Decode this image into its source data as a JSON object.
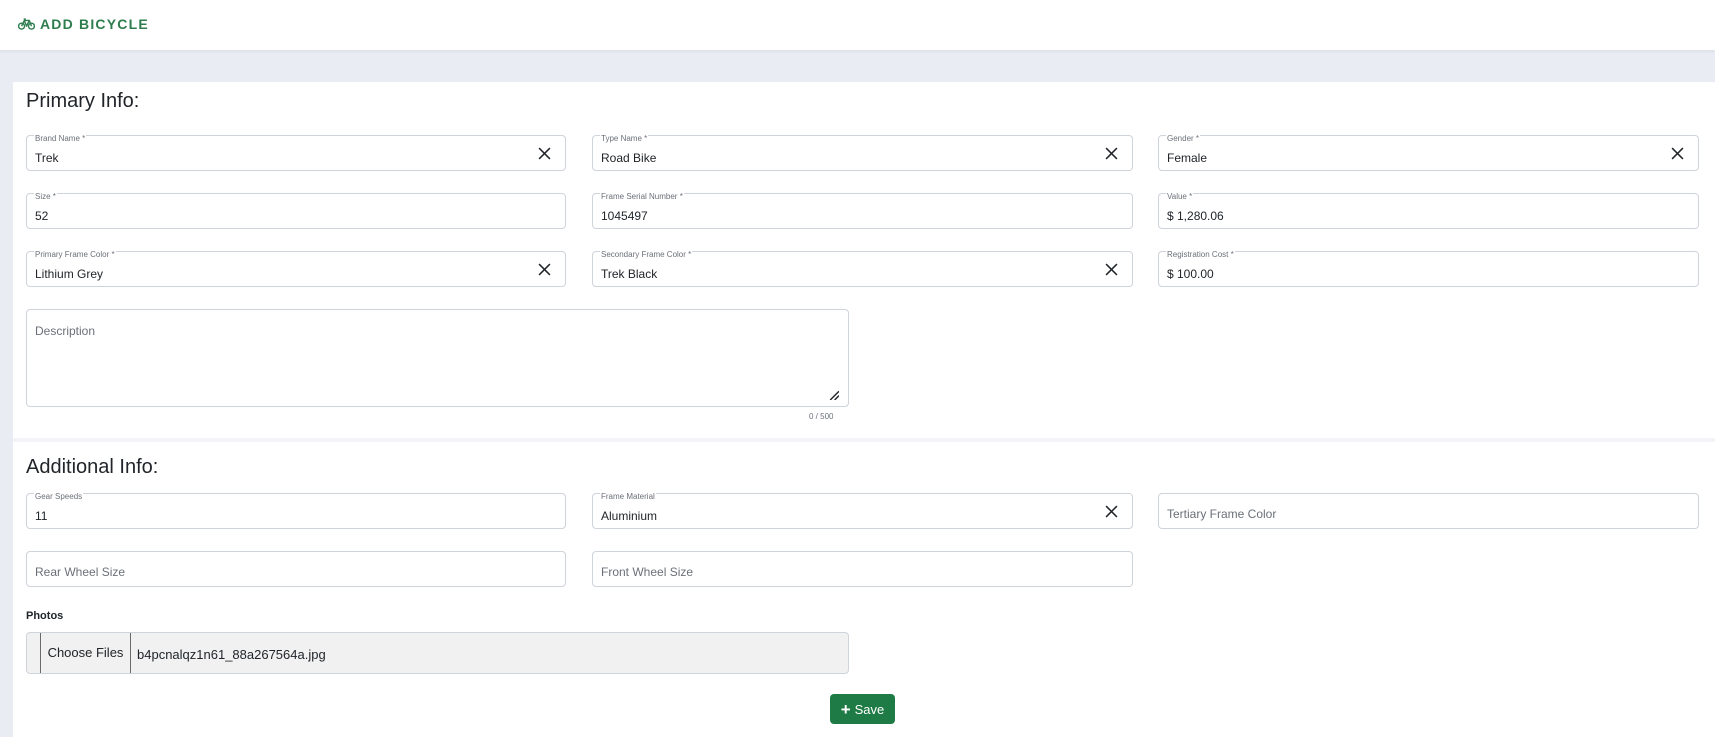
{
  "header": {
    "title": "ADD BICYCLE",
    "icon": "bicycle-icon",
    "accent": "#2e7d4f"
  },
  "primary": {
    "title": "Primary Info:",
    "brand": {
      "label": "Brand Name *",
      "value": "Trek"
    },
    "type": {
      "label": "Type Name *",
      "value": "Road Bike"
    },
    "gender": {
      "label": "Gender *",
      "value": "Female"
    },
    "size": {
      "label": "Size *",
      "value": "52"
    },
    "serial": {
      "label": "Frame Serial Number *",
      "value": "1045497"
    },
    "value": {
      "label": "Value *",
      "value": "$ 1,280.06"
    },
    "primary_color": {
      "label": "Primary Frame Color *",
      "value": "Lithium Grey"
    },
    "secondary_color": {
      "label": "Secondary Frame Color *",
      "value": "Trek Black"
    },
    "registration_cost": {
      "label": "Registration Cost *",
      "value": "$ 100.00"
    },
    "description": {
      "placeholder": "Description",
      "counter": "0 / 500"
    }
  },
  "additional": {
    "title": "Additional Info:",
    "gear_speeds": {
      "label": "Gear Speeds",
      "value": "11"
    },
    "frame_material": {
      "label": "Frame Material",
      "value": "Aluminium"
    },
    "tertiary_color": {
      "placeholder": "Tertiary Frame Color"
    },
    "rear_wheel": {
      "placeholder": "Rear Wheel Size"
    },
    "front_wheel": {
      "placeholder": "Front Wheel Size"
    }
  },
  "photos": {
    "label": "Photos",
    "button_label": "Choose Files",
    "file_name": "b4pcnalqz1n61_88a267564a.jpg"
  },
  "save": {
    "label": "Save",
    "color": "#1e7b45"
  }
}
